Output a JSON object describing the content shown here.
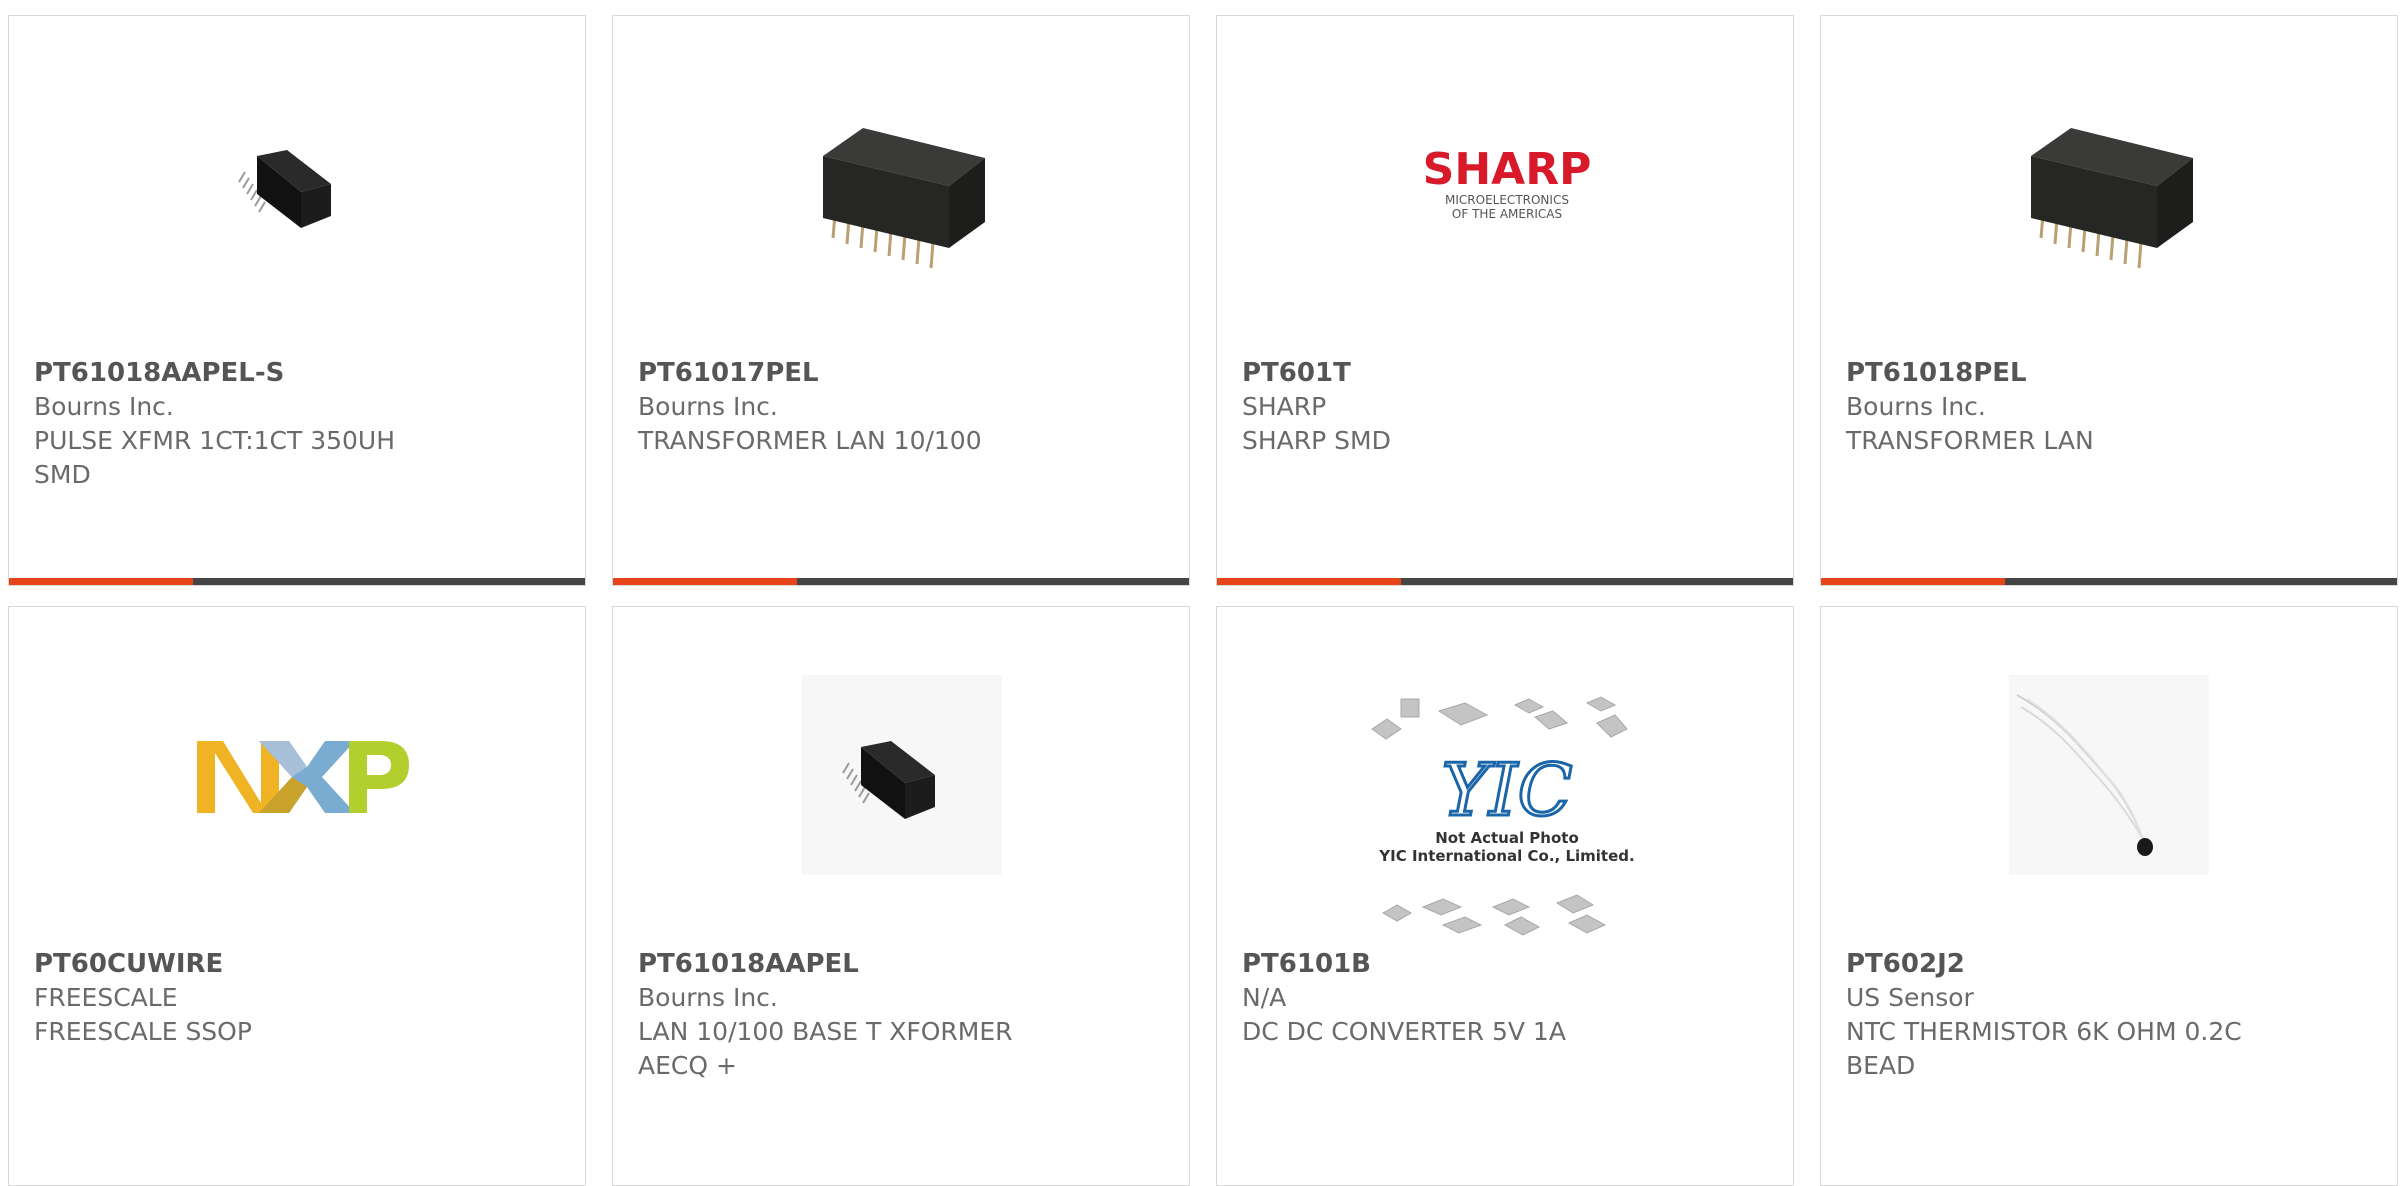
{
  "colors": {
    "accent": "#e8441a",
    "bar_track": "#454545",
    "text": "#666666",
    "card_border": "#d8d8d8"
  },
  "products": [
    {
      "part": "PT61018AAPEL-S",
      "maker": "Bourns Inc.",
      "desc": "PULSE XFMR 1CT:1CT 350UH SMD",
      "image": "small-transformer-chip-icon",
      "progress": 0.32
    },
    {
      "part": "PT61017PEL",
      "maker": "Bourns Inc.",
      "desc": "TRANSFORMER LAN 10/100",
      "image": "transformer-chip-icon",
      "progress": 0.32
    },
    {
      "part": "PT601T",
      "maker": "SHARP",
      "desc": "SHARP SMD",
      "image": "sharp-logo",
      "progress": 0.32,
      "logo": {
        "main": "SHARP",
        "line1": "MICROELECTRONICS",
        "line2": "OF THE AMERICAS"
      }
    },
    {
      "part": "PT61018PEL",
      "maker": "Bourns Inc.",
      "desc": "TRANSFORMER LAN",
      "image": "transformer-chip-icon",
      "progress": 0.32
    },
    {
      "part": "PT60CUWIRE",
      "maker": "FREESCALE",
      "desc": "FREESCALE SSOP",
      "image": "nxp-logo",
      "logo": {
        "main": "NXP"
      }
    },
    {
      "part": "PT61018AAPEL",
      "maker": "Bourns Inc.",
      "desc": "LAN 10/100 BASE T XFORMER AECQ +",
      "image": "small-transformer-chip-icon"
    },
    {
      "part": "PT6101B",
      "maker": "N/A",
      "desc": "DC DC CONVERTER 5V 1A",
      "image": "yic-placeholder-image",
      "logo": {
        "main": "YIC",
        "line1": "Not Actual Photo",
        "line2": "YIC International Co., Limited."
      }
    },
    {
      "part": "PT602J2",
      "maker": "US Sensor",
      "desc": "NTC THERMISTOR 6K OHM 0.2C BEAD",
      "image": "thermistor-photo"
    }
  ]
}
